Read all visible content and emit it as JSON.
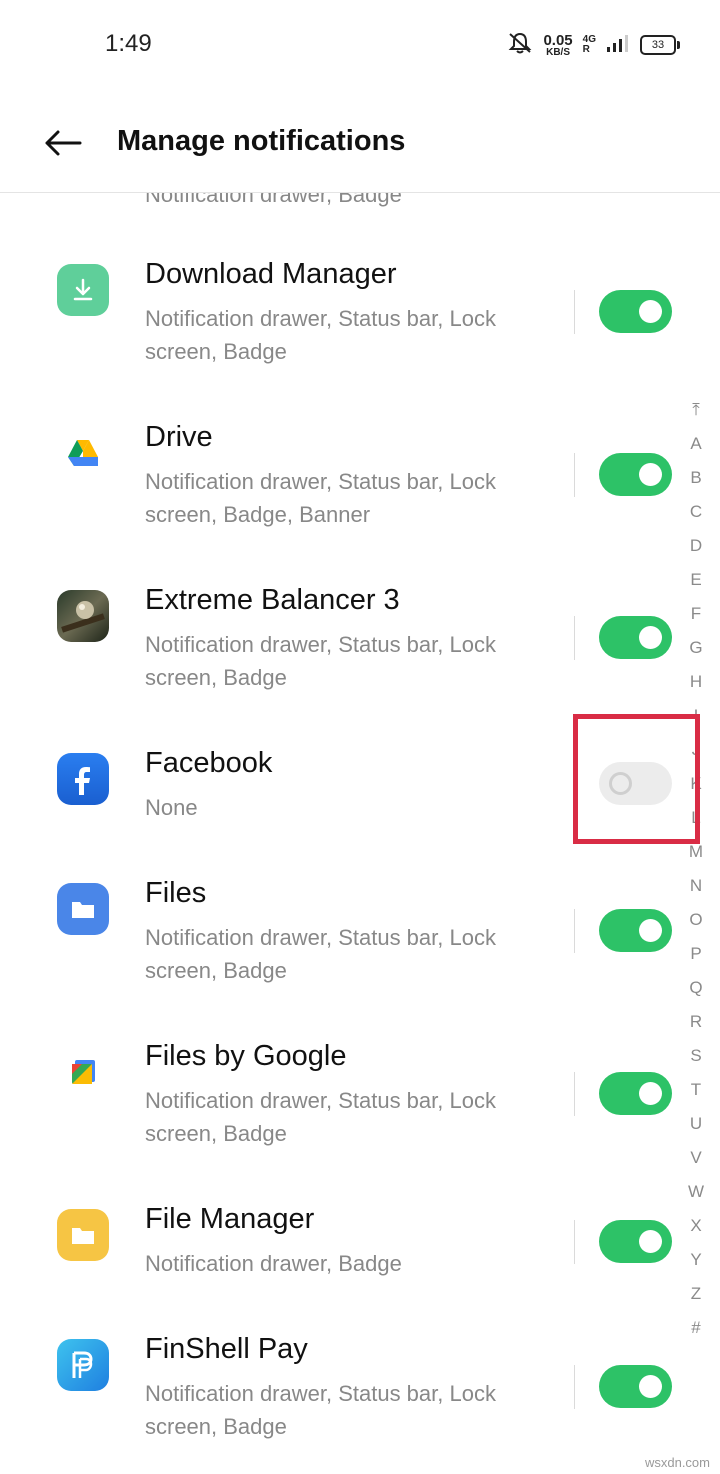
{
  "status_bar": {
    "time": "1:49",
    "net_speed_value": "0.05",
    "net_speed_unit": "KB/S",
    "network_type": "4G",
    "network_roaming": "R",
    "battery": "33"
  },
  "header": {
    "title": "Manage notifications"
  },
  "cut_item": {
    "subtitle": "Notification drawer, Badge"
  },
  "apps": [
    {
      "name": "Download Manager",
      "subtitle": "Notification drawer, Status bar, Lock screen, Badge",
      "enabled": true,
      "icon": "download-icon"
    },
    {
      "name": "Drive",
      "subtitle": "Notification drawer, Status bar, Lock screen, Badge, Banner",
      "enabled": true,
      "icon": "drive-icon"
    },
    {
      "name": "Extreme Balancer 3",
      "subtitle": "Notification drawer, Status bar, Lock screen, Badge",
      "enabled": true,
      "icon": "game-icon"
    },
    {
      "name": "Facebook",
      "subtitle": "None",
      "enabled": false,
      "icon": "facebook-icon"
    },
    {
      "name": "Files",
      "subtitle": "Notification drawer, Status bar, Lock screen, Badge",
      "enabled": true,
      "icon": "folder-icon"
    },
    {
      "name": "Files by Google",
      "subtitle": "Notification drawer, Status bar, Lock screen, Badge",
      "enabled": true,
      "icon": "files-by-google-icon"
    },
    {
      "name": "File Manager",
      "subtitle": "Notification drawer, Badge",
      "enabled": true,
      "icon": "folder-icon"
    },
    {
      "name": "FinShell Pay",
      "subtitle": "Notification drawer, Status bar, Lock screen, Badge",
      "enabled": true,
      "icon": "finshell-icon"
    }
  ],
  "index_bar": {
    "top_symbol": "⤒",
    "letters": [
      "A",
      "B",
      "C",
      "D",
      "E",
      "F",
      "G",
      "H",
      "I",
      "J",
      "K",
      "L",
      "M",
      "N",
      "O",
      "P",
      "Q",
      "R",
      "S",
      "T",
      "U",
      "V",
      "W",
      "X",
      "Y",
      "Z",
      "#"
    ]
  },
  "colors": {
    "toggle_on": "#2dc267",
    "toggle_off": "#ececec",
    "highlight": "#d92c45",
    "facebook_blue": "#1877f2",
    "files_blue": "#4a86e8",
    "file_manager_yellow": "#f6c544",
    "download_green": "#5fcf9a"
  },
  "watermark": "wsxdn.com"
}
